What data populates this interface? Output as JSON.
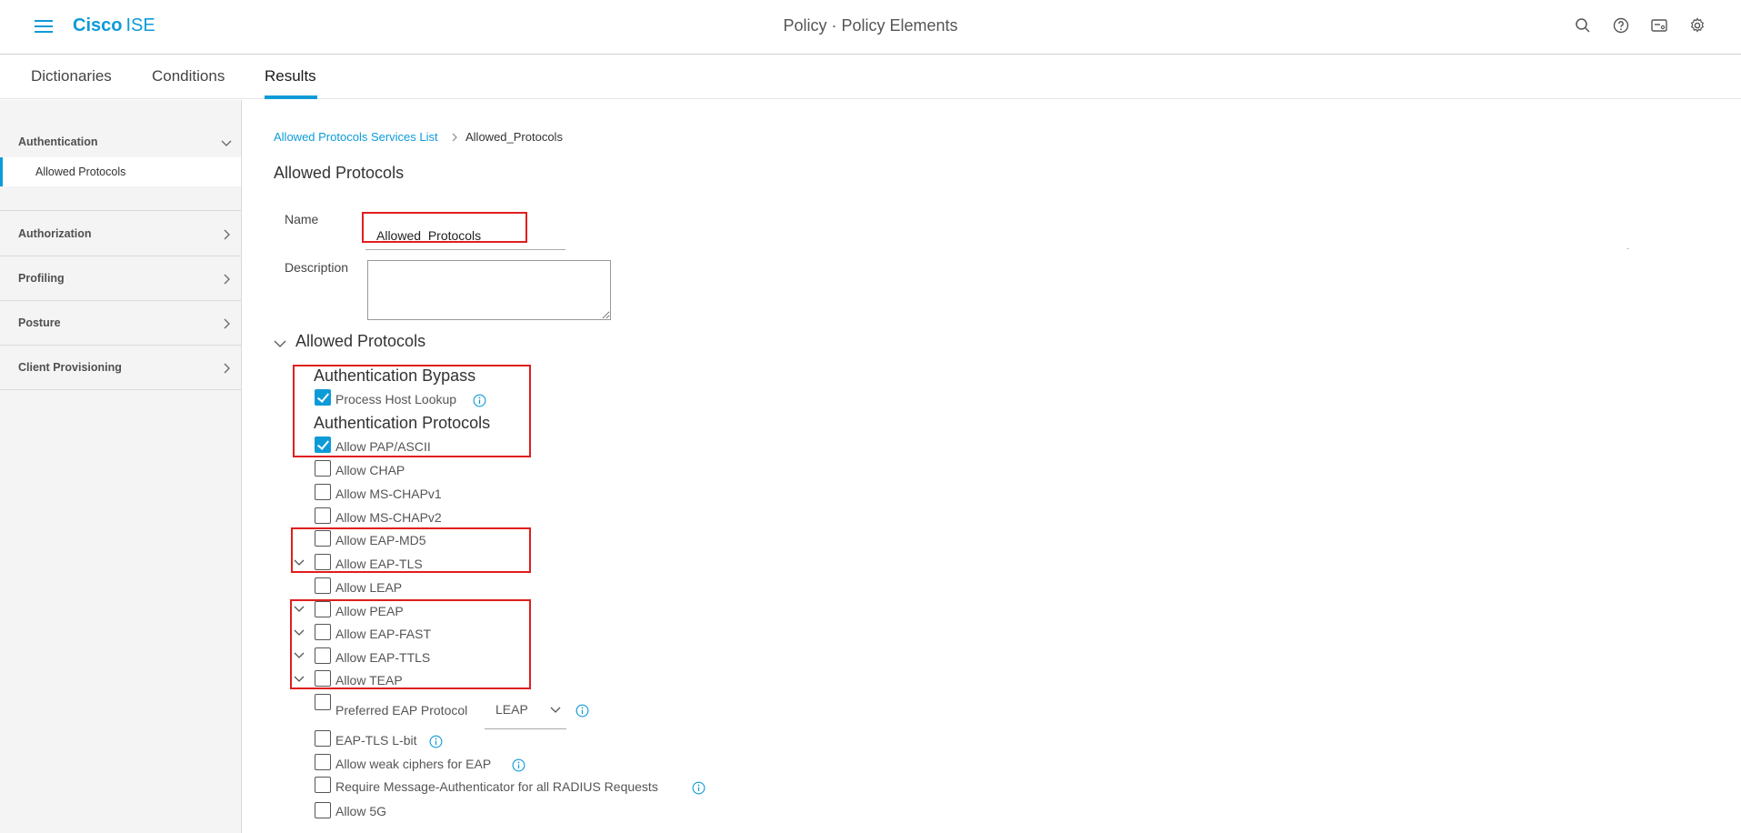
{
  "header": {
    "brand_bold": "Cisco",
    "brand_light": "ISE",
    "title": "Policy · Policy Elements"
  },
  "tabs": [
    {
      "label": "Dictionaries"
    },
    {
      "label": "Conditions"
    },
    {
      "label": "Results",
      "active": true
    }
  ],
  "sidebar": {
    "sections": [
      {
        "label": "Authentication",
        "expanded": true
      },
      {
        "label": "Authorization",
        "expanded": false
      },
      {
        "label": "Profiling",
        "expanded": false
      },
      {
        "label": "Posture",
        "expanded": false
      },
      {
        "label": "Client Provisioning",
        "expanded": false
      }
    ],
    "selected_item": "Allowed Protocols"
  },
  "breadcrumb": {
    "parent": "Allowed Protocols Services List",
    "current": "Allowed_Protocols"
  },
  "form": {
    "heading": "Allowed Protocols",
    "name_label": "Name",
    "name_value": "Allowed_Protocols",
    "description_label": "Description",
    "description_value": ""
  },
  "allowed_protocols": {
    "section_title": "Allowed Protocols",
    "bypass_heading": "Authentication Bypass",
    "protocols_heading": "Authentication Protocols",
    "items": [
      {
        "label": "Process Host Lookup",
        "checked": true
      },
      {
        "label": "Allow PAP/ASCII",
        "checked": true
      },
      {
        "label": "Allow CHAP",
        "checked": false
      },
      {
        "label": "Allow MS-CHAPv1",
        "checked": false
      },
      {
        "label": "Allow MS-CHAPv2",
        "checked": false
      },
      {
        "label": "Allow EAP-MD5",
        "checked": false
      },
      {
        "label": "Allow EAP-TLS",
        "checked": false
      },
      {
        "label": "Allow LEAP",
        "checked": false
      },
      {
        "label": "Allow PEAP",
        "checked": false
      },
      {
        "label": "Allow EAP-FAST",
        "checked": false
      },
      {
        "label": "Allow EAP-TTLS",
        "checked": false
      },
      {
        "label": "Allow TEAP",
        "checked": false
      },
      {
        "label": "Preferred EAP Protocol",
        "checked": false
      },
      {
        "label": "EAP-TLS L-bit",
        "checked": false
      },
      {
        "label": "Allow weak ciphers for EAP",
        "checked": false
      },
      {
        "label": "Require Message-Authenticator for all RADIUS Requests",
        "checked": false
      },
      {
        "label": "Allow 5G",
        "checked": false
      }
    ],
    "preferred_eap_value": "LEAP"
  },
  "colors": {
    "accent": "#0d9bd8",
    "highlight_box": "#e01e1e"
  }
}
